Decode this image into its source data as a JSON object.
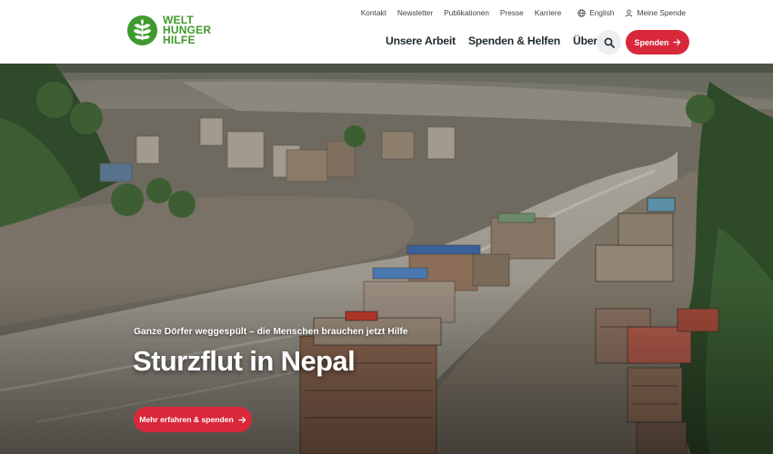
{
  "brand": {
    "logo_lines": [
      "WELT",
      "HUNGER",
      "HILFE"
    ],
    "color": "#3f9a2e"
  },
  "utility_nav": {
    "links": [
      "Kontakt",
      "Newsletter",
      "Publikationen",
      "Presse",
      "Karriere"
    ],
    "language": "English",
    "account": "Meine Spende",
    "language_icon": "globe-icon",
    "account_icon": "user-icon"
  },
  "main_nav": {
    "items": [
      "Unsere Arbeit",
      "Spenden & Helfen",
      "Über uns"
    ]
  },
  "header_actions": {
    "search_icon": "search-icon",
    "donate_label": "Spenden",
    "accent_color": "#d8283a"
  },
  "hero": {
    "subtitle": "Ganze Dörfer weggespült – die Menschen brauchen jetzt Hilfe",
    "title": "Sturzflut in Nepal",
    "cta_label": "Mehr erfahren & spenden",
    "image_alt": "Flooded river valley with damaged buildings in Nepal"
  }
}
